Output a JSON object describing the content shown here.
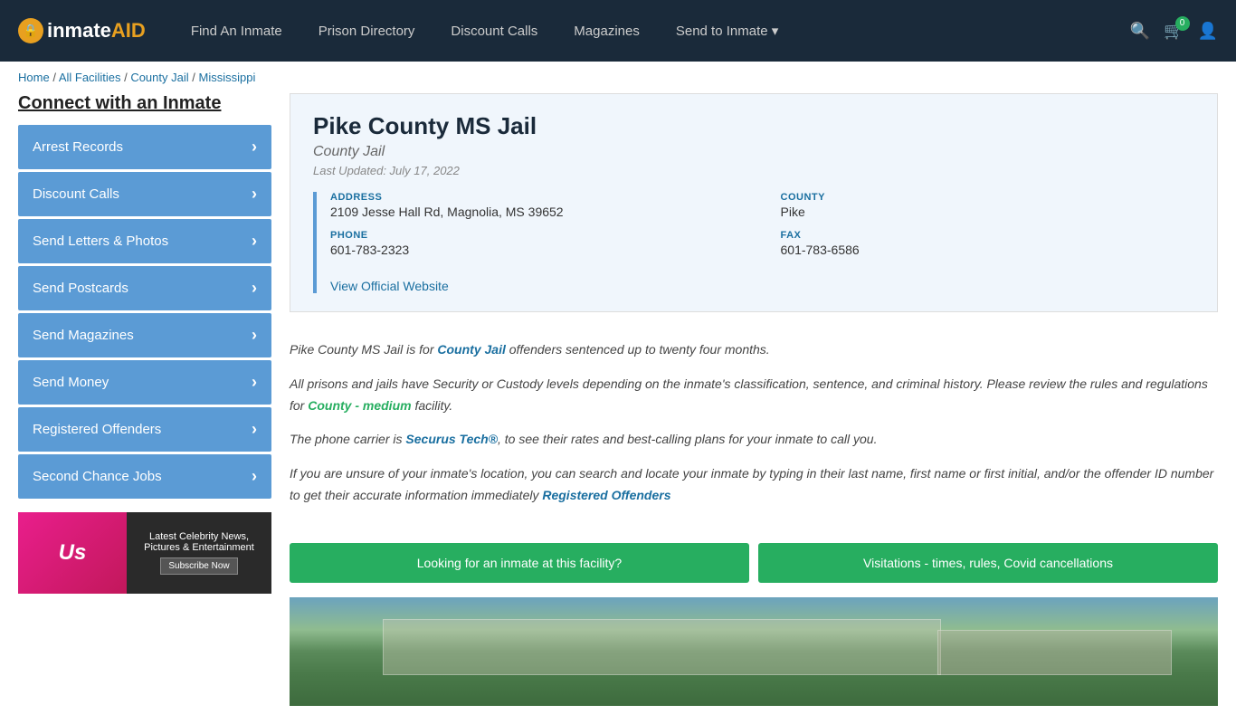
{
  "header": {
    "logo_text": "inmateAID",
    "nav": [
      {
        "label": "Find An Inmate",
        "href": "#",
        "dropdown": false
      },
      {
        "label": "Prison Directory",
        "href": "#",
        "dropdown": false
      },
      {
        "label": "Discount Calls",
        "href": "#",
        "dropdown": false
      },
      {
        "label": "Magazines",
        "href": "#",
        "dropdown": false
      },
      {
        "label": "Send to Inmate",
        "href": "#",
        "dropdown": true
      }
    ],
    "cart_count": "0",
    "icons": {
      "search": "🔍",
      "cart": "🛒",
      "user": "👤"
    }
  },
  "breadcrumb": {
    "items": [
      {
        "label": "Home",
        "href": "#"
      },
      {
        "label": "All Facilities",
        "href": "#"
      },
      {
        "label": "County Jail",
        "href": "#"
      },
      {
        "label": "Mississippi",
        "href": "#"
      }
    ]
  },
  "sidebar": {
    "title": "Connect with an Inmate",
    "items": [
      {
        "label": "Arrest Records"
      },
      {
        "label": "Discount Calls"
      },
      {
        "label": "Send Letters & Photos"
      },
      {
        "label": "Send Postcards"
      },
      {
        "label": "Send Magazines"
      },
      {
        "label": "Send Money"
      },
      {
        "label": "Registered Offenders"
      },
      {
        "label": "Second Chance Jobs"
      }
    ],
    "ad": {
      "brand": "Us",
      "tagline": "Latest Celebrity News, Pictures & Entertainment",
      "button_label": "Subscribe Now"
    }
  },
  "facility": {
    "name": "Pike County MS Jail",
    "type": "County Jail",
    "last_updated": "Last Updated: July 17, 2022",
    "address_label": "ADDRESS",
    "address_value": "2109 Jesse Hall Rd, Magnolia, MS 39652",
    "county_label": "COUNTY",
    "county_value": "Pike",
    "phone_label": "PHONE",
    "phone_value": "601-783-2323",
    "fax_label": "FAX",
    "fax_value": "601-783-6586",
    "website_link": "View Official Website"
  },
  "description": {
    "para1_pre": "Pike County MS Jail is for ",
    "para1_link": "County Jail",
    "para1_post": " offenders sentenced up to twenty four months.",
    "para2_pre": "All prisons and jails have Security or Custody levels depending on the inmate's classification, sentence, and criminal history. Please review the rules and regulations for ",
    "para2_link": "County - medium",
    "para2_post": " facility.",
    "para3_pre": "The phone carrier is ",
    "para3_link": "Securus Tech®",
    "para3_post": ", to see their rates and best-calling plans for your inmate to call you.",
    "para4": "If you are unsure of your inmate's location, you can search and locate your inmate by typing in their last name, first name or first initial, and/or the offender ID number to get their accurate information immediately ",
    "para4_link": "Registered Offenders"
  },
  "buttons": {
    "lookup": "Looking for an inmate at this facility?",
    "visitations": "Visitations - times, rules, Covid cancellations"
  }
}
